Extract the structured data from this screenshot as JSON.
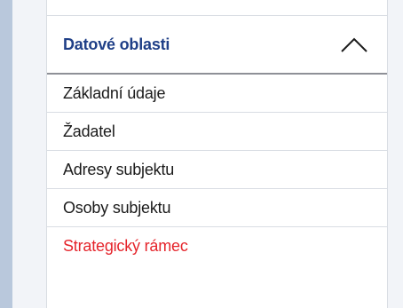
{
  "section": {
    "title": "Datové oblasti",
    "toggle_icon": "chevron-up-icon",
    "items": [
      {
        "label": "Základní údaje",
        "active": false
      },
      {
        "label": "Žadatel",
        "active": false
      },
      {
        "label": "Adresy subjektu",
        "active": false
      },
      {
        "label": "Osoby subjektu",
        "active": false
      },
      {
        "label": "Strategický rámec",
        "active": true
      }
    ]
  },
  "colors": {
    "title": "#1f3f87",
    "active_item": "#e5242b",
    "left_strip": "#b9c8dc",
    "border": "#d9dde3"
  }
}
